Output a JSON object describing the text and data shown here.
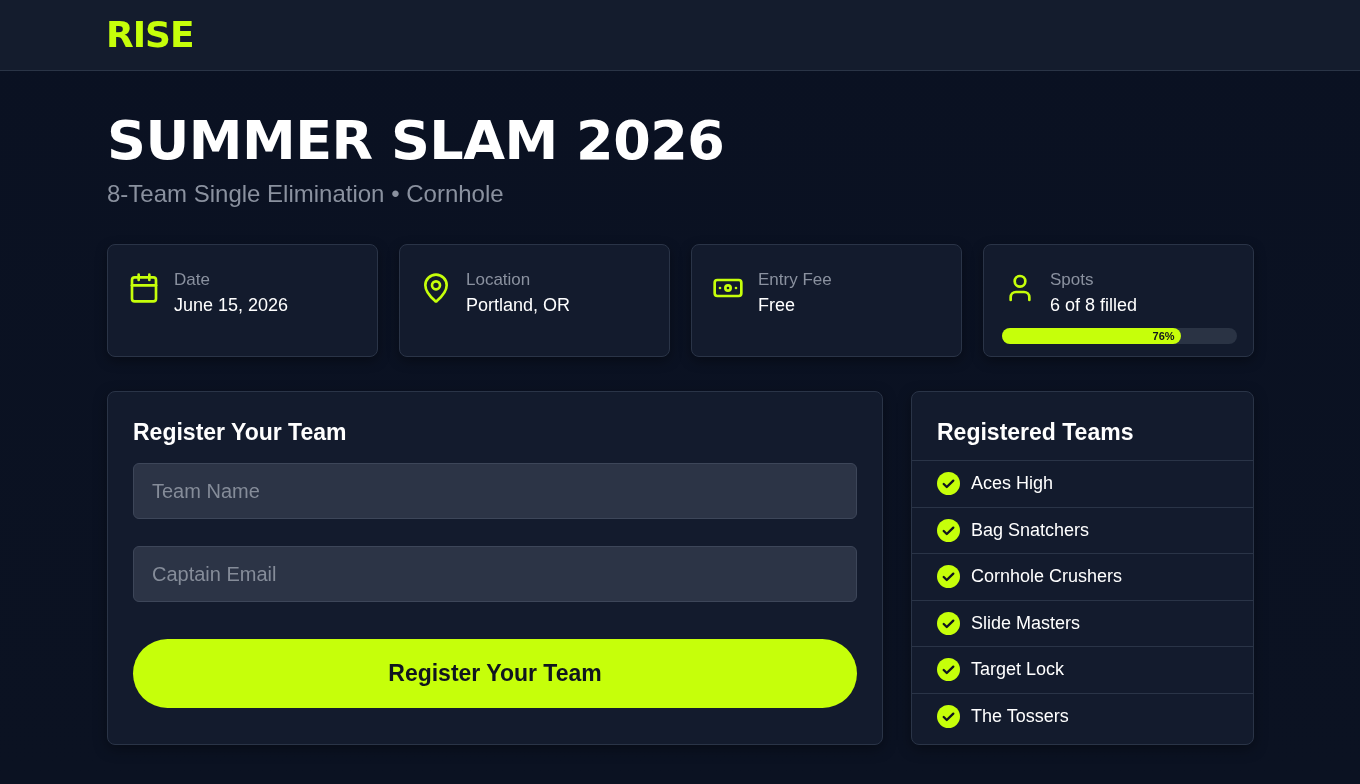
{
  "header": {
    "logo": "RISE"
  },
  "event": {
    "title": "SUMMER SLAM 2026",
    "subtitle": "8-Team Single Elimination • Cornhole"
  },
  "info_cards": [
    {
      "kind": "date",
      "label": "Date",
      "value": "June 15, 2026"
    },
    {
      "kind": "location",
      "label": "Location",
      "value": "Portland, OR"
    },
    {
      "kind": "fee",
      "label": "Entry Fee",
      "value": "Free"
    },
    {
      "kind": "spots",
      "label": "Spots",
      "value": "6 of 8 filled",
      "level": 0.76,
      "reading": "76%"
    }
  ],
  "registration_form": {
    "title": "Register Your Team",
    "fields": [
      {
        "placeholder": "Team Name"
      },
      {
        "placeholder": "Captain Email"
      }
    ],
    "submit_button": "Register Your Team"
  },
  "registered_teams": {
    "title": "Registered Teams",
    "teams": [
      {
        "name": "Aces High",
        "confirmed": true
      },
      {
        "name": "Bag Snatchers",
        "confirmed": true
      },
      {
        "name": "Cornhole Crushers",
        "confirmed": true
      },
      {
        "name": "Slide Masters",
        "confirmed": true
      },
      {
        "name": "Target Lock",
        "confirmed": true
      },
      {
        "name": "The Tossers",
        "confirmed": true
      }
    ]
  }
}
